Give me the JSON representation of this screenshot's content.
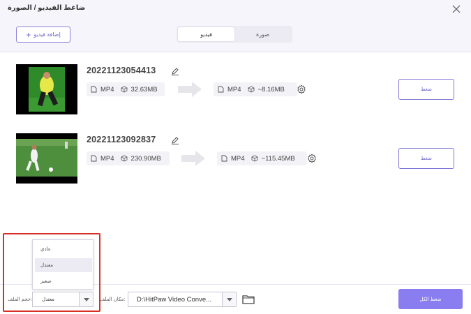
{
  "window": {
    "title": "ضاغط الفيديو / الصورة"
  },
  "toolbar": {
    "add_video_label": "إضافة فيديو",
    "tabs": [
      {
        "label": "فيديو",
        "active": true
      },
      {
        "label": "صورة",
        "active": false
      }
    ]
  },
  "files": [
    {
      "name": "20221123054413",
      "source": {
        "format": "MP4",
        "size": "32.63MB"
      },
      "output": {
        "format": "MP4",
        "size": "~8.16MB"
      },
      "compress_label": "ضغط"
    },
    {
      "name": "20221123092837",
      "source": {
        "format": "MP4",
        "size": "230.90MB"
      },
      "output": {
        "format": "MP4",
        "size": "~115.45MB"
      },
      "compress_label": "ضغط"
    }
  ],
  "bottom": {
    "file_size_label": "حجم الملف:",
    "file_size_value": "معتدل",
    "file_location_label": "مكان الملف:",
    "file_location_value": "D:\\HitPaw Video Conve...",
    "compress_all_label": "ضغط الكل"
  },
  "size_dropdown": {
    "options": [
      "عادي",
      "معتدل",
      "صغير"
    ],
    "selected_index": 1
  },
  "colors": {
    "accent": "#8a7df0",
    "accent_border": "#7d75d6",
    "highlight": "#d93025",
    "header_bg": "#f6f5fb"
  }
}
